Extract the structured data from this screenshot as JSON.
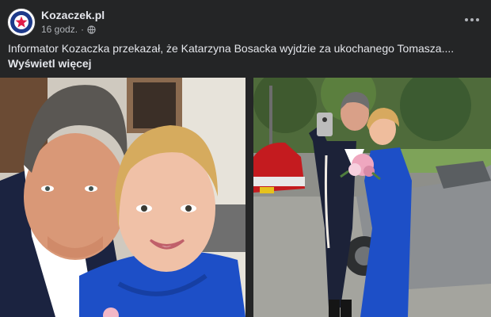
{
  "post": {
    "page_name": "Kozaczek.pl",
    "time": "16 godz.",
    "separator": "·",
    "text": "Informator Kozaczka przekazał, że Katarzyna Bosacka wyjdzie za ukochanego Tomasza.... ",
    "see_more": "Wyświetl więcej"
  },
  "icons": {
    "avatar": "kozaczek-star-logo",
    "privacy": "globe-icon",
    "more": "more-dots-icon"
  },
  "photos": [
    {
      "name": "selfie-couple-photo"
    },
    {
      "name": "couple-by-cars-photo"
    }
  ],
  "colors": {
    "background": "#242526",
    "text": "#e4e6eb",
    "secondary_text": "#b0b3b8",
    "dress_blue": "#1d4fc7"
  }
}
